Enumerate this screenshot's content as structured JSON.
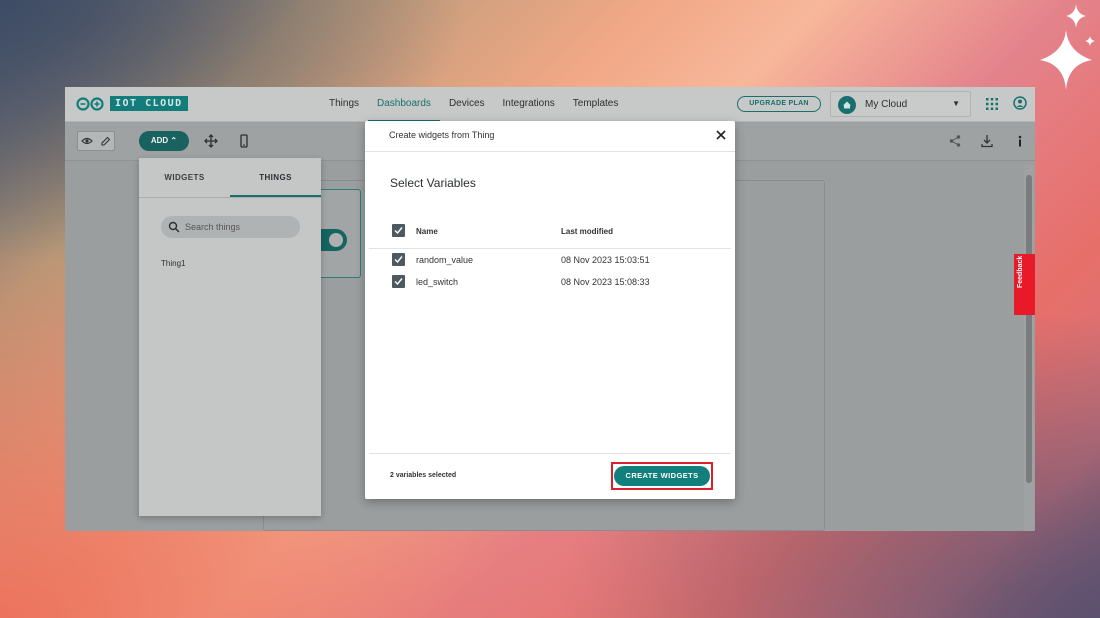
{
  "app": {
    "logo_text": "IOT CLOUD",
    "nav": [
      "Things",
      "Dashboards",
      "Devices",
      "Integrations",
      "Templates"
    ],
    "active_nav": "Dashboards",
    "upgrade_label": "UPGRADE PLAN",
    "cloud_label": "My Cloud"
  },
  "toolbar": {
    "add_label": "ADD ⌃"
  },
  "panel": {
    "tabs": [
      "WIDGETS",
      "THINGS"
    ],
    "search_placeholder": "Search things",
    "things": [
      "Thing1"
    ]
  },
  "feedback_label": "Feedback",
  "modal": {
    "title": "Create widgets from Thing",
    "heading": "Select Variables",
    "columns": {
      "name": "Name",
      "modified": "Last modified"
    },
    "rows": [
      {
        "name": "random_value",
        "modified": "08 Nov 2023 15:03:51",
        "checked": true
      },
      {
        "name": "led_switch",
        "modified": "08 Nov 2023 15:08:33",
        "checked": true
      }
    ],
    "selected_count": "2 variables selected",
    "create_label": "CREATE WIDGETS"
  },
  "colors": {
    "accent": "#1a6e6d",
    "primary_button": "#11807d",
    "highlight_outline": "#d9202b",
    "feedback": "#e81a2a"
  }
}
